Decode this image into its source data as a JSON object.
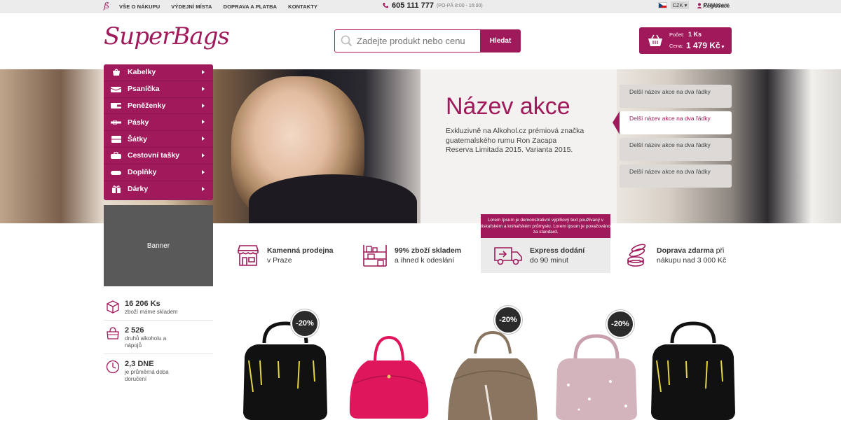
{
  "topbar": {
    "nav": [
      "VŠE O NÁKUPU",
      "VÝDEJNÍ MÍSTA",
      "DOPRAVA A PLATBA",
      "KONTAKTY"
    ],
    "phone": "605 111 777",
    "hours": "(PO-PÁ 8:00 - 16:00)",
    "currency": "CZK",
    "login": "Přihlášení",
    "register": "Registrace"
  },
  "header": {
    "brand": "SuperBags",
    "search_placeholder": "Zadejte produkt nebo cenu",
    "search_button": "Hledat",
    "cart": {
      "count_label": "Počet:",
      "count_value": "1 Ks",
      "price_label": "Cena:",
      "price_value": "1 479 Kč"
    }
  },
  "categories": [
    "Kabelky",
    "Psaníčka",
    "Peněženky",
    "Pásky",
    "Šátky",
    "Cestovní tašky",
    "Doplňky",
    "Dárky"
  ],
  "banner": "Banner",
  "hero": {
    "title": "Název akce",
    "description": "Exkluzivně na Alkohol.cz prémiová značka guatemalského rumu Ron Zacapa Reserva Limitada 2015. Varianta 2015.",
    "slides": [
      "Delší název akce na dva řádky",
      "Delší název akce na dva řádky",
      "Delší název akce na dva řádky",
      "Delší název akce na dva řádky"
    ]
  },
  "stats": [
    {
      "value": "16 206 Ks",
      "text": "zboží máme skladem"
    },
    {
      "value": "2 526",
      "text": "druhů alkoholu a nápojů"
    },
    {
      "value": "2,3 DNE",
      "text": "je průměrná doba doručení"
    }
  ],
  "features": [
    {
      "title": "Kamenná prodejna",
      "sub": "v Praze"
    },
    {
      "title": "99% zboží skladem",
      "sub": "a ihned k odeslání"
    },
    {
      "title": "Express dodání",
      "sub": "do 90 minut"
    },
    {
      "title": "Doprava zdarma",
      "title_rest": " při",
      "sub": "nákupu nad 3 000 Kč"
    }
  ],
  "tooltip": "Lorem Ipsum je demonstrativní výplňový text používaný v tiskařském a knihařském průmyslu. Lorem Ipsum je považováno za standard.",
  "products": [
    {
      "discount": "-20%",
      "color": "#111111"
    },
    {
      "discount": "",
      "color": "#e0165d"
    },
    {
      "discount": "-20%",
      "color": "#8a7560"
    },
    {
      "discount": "-20%",
      "color": "#c8a0ad"
    },
    {
      "discount": "",
      "color": "#111111"
    }
  ],
  "colors": {
    "brand": "#a0195a",
    "banner": "#595959"
  }
}
